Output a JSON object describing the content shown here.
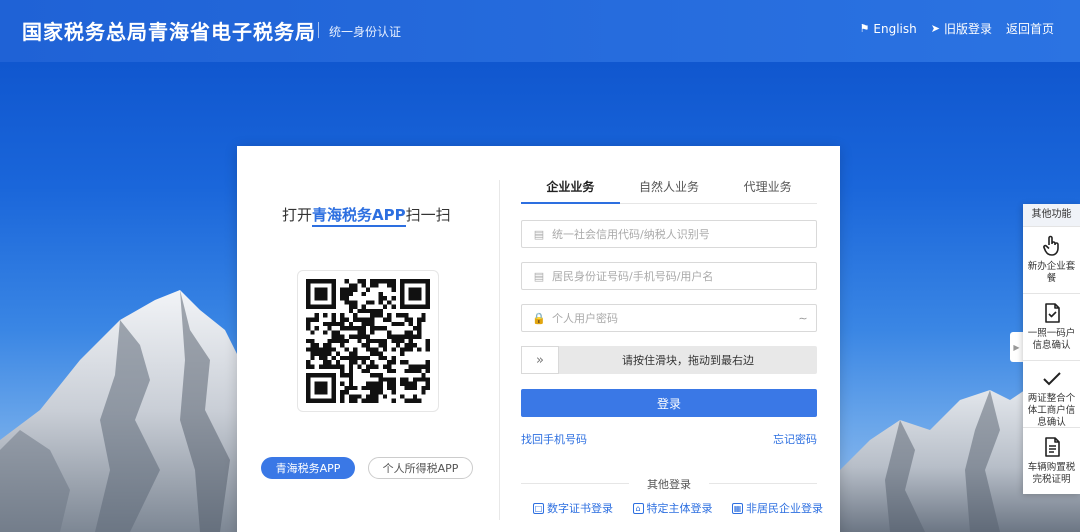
{
  "header": {
    "title": "国家税务总局青海省电子税务局",
    "subtitle": "统一身份认证",
    "links": [
      {
        "icon": "english-flag-icon",
        "label": "English"
      },
      {
        "icon": "send-icon",
        "label": "旧版登录"
      },
      {
        "icon": "",
        "label": "返回首页"
      }
    ]
  },
  "qr_panel": {
    "title_prefix": "打开",
    "title_highlight": "青海税务APP",
    "title_suffix": "扫一扫",
    "buttons": [
      "青海税务APP",
      "个人所得税APP"
    ]
  },
  "login": {
    "tabs": [
      "企业业务",
      "自然人业务",
      "代理业务"
    ],
    "active_tab": 0,
    "fields": {
      "credit_code_placeholder": "统一社会信用代码/纳税人识别号",
      "id_placeholder": "居民身份证号码/手机号码/用户名",
      "password_placeholder": "个人用户密码"
    },
    "slider_text": "请按住滑块，拖动到最右边",
    "submit_label": "登录",
    "forgot_phone": "找回手机号码",
    "forgot_password": "忘记密码",
    "other_title": "其他登录",
    "other_links": [
      "数字证书登录",
      "特定主体登录",
      "非居民企业登录"
    ]
  },
  "side_panel": {
    "title": "其他功能",
    "items": [
      {
        "icon": "hand-pointer-icon",
        "label": "新办企业套餐"
      },
      {
        "icon": "document-check-icon",
        "label": "一照一码户信息确认"
      },
      {
        "icon": "checkmark-icon",
        "label": "两证整合个体工商户信息确认"
      },
      {
        "icon": "document-icon",
        "label": "车辆购置税完税证明"
      }
    ]
  },
  "colors": {
    "header": "#2468da",
    "accent": "#3a78e6"
  }
}
